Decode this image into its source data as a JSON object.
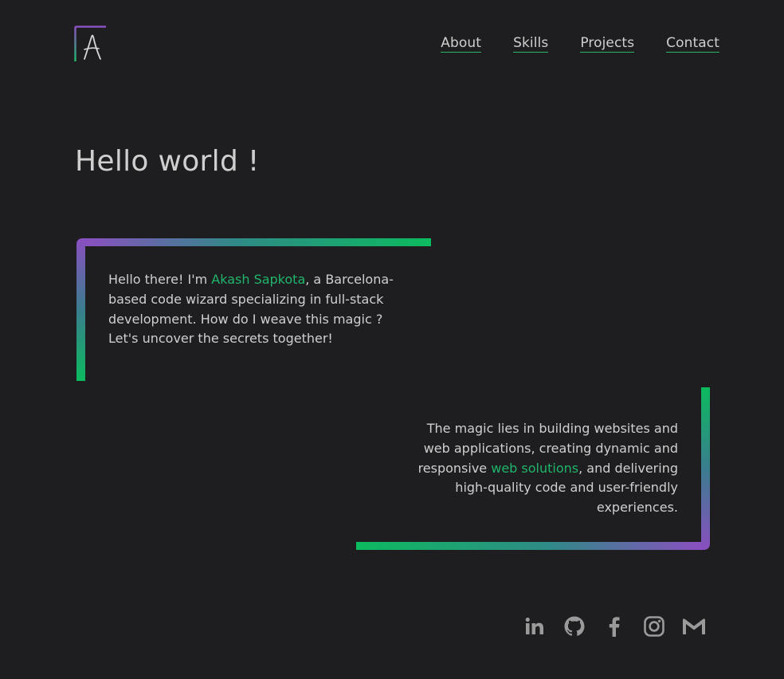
{
  "brand": {
    "logo_letter": "A"
  },
  "nav": {
    "items": [
      {
        "label": "About"
      },
      {
        "label": "Skills"
      },
      {
        "label": "Projects"
      },
      {
        "label": "Contact"
      }
    ]
  },
  "hero": {
    "title": "Hello world !"
  },
  "intro": {
    "before": "Hello there! I'm ",
    "highlight": "Akash Sapkota",
    "after": ", a Barcelona-based code wizard specializing in full-stack development. How do I weave this magic ? Let's uncover the secrets together!"
  },
  "magic": {
    "before": "The magic lies in building websites and web applications, creating dynamic and responsive ",
    "highlight": "web solutions",
    "after": ", and delivering high-quality code and user-friendly experiences."
  },
  "socials": [
    {
      "icon": "linkedin-icon"
    },
    {
      "icon": "github-icon"
    },
    {
      "icon": "facebook-icon"
    },
    {
      "icon": "instagram-icon"
    },
    {
      "icon": "gmail-icon"
    }
  ],
  "colors": {
    "background": "#1e1e21",
    "accent_green": "#1fb56b",
    "accent_purple": "#8a4fc0",
    "text": "#cfcfcf",
    "icon": "#9a9a9a"
  }
}
